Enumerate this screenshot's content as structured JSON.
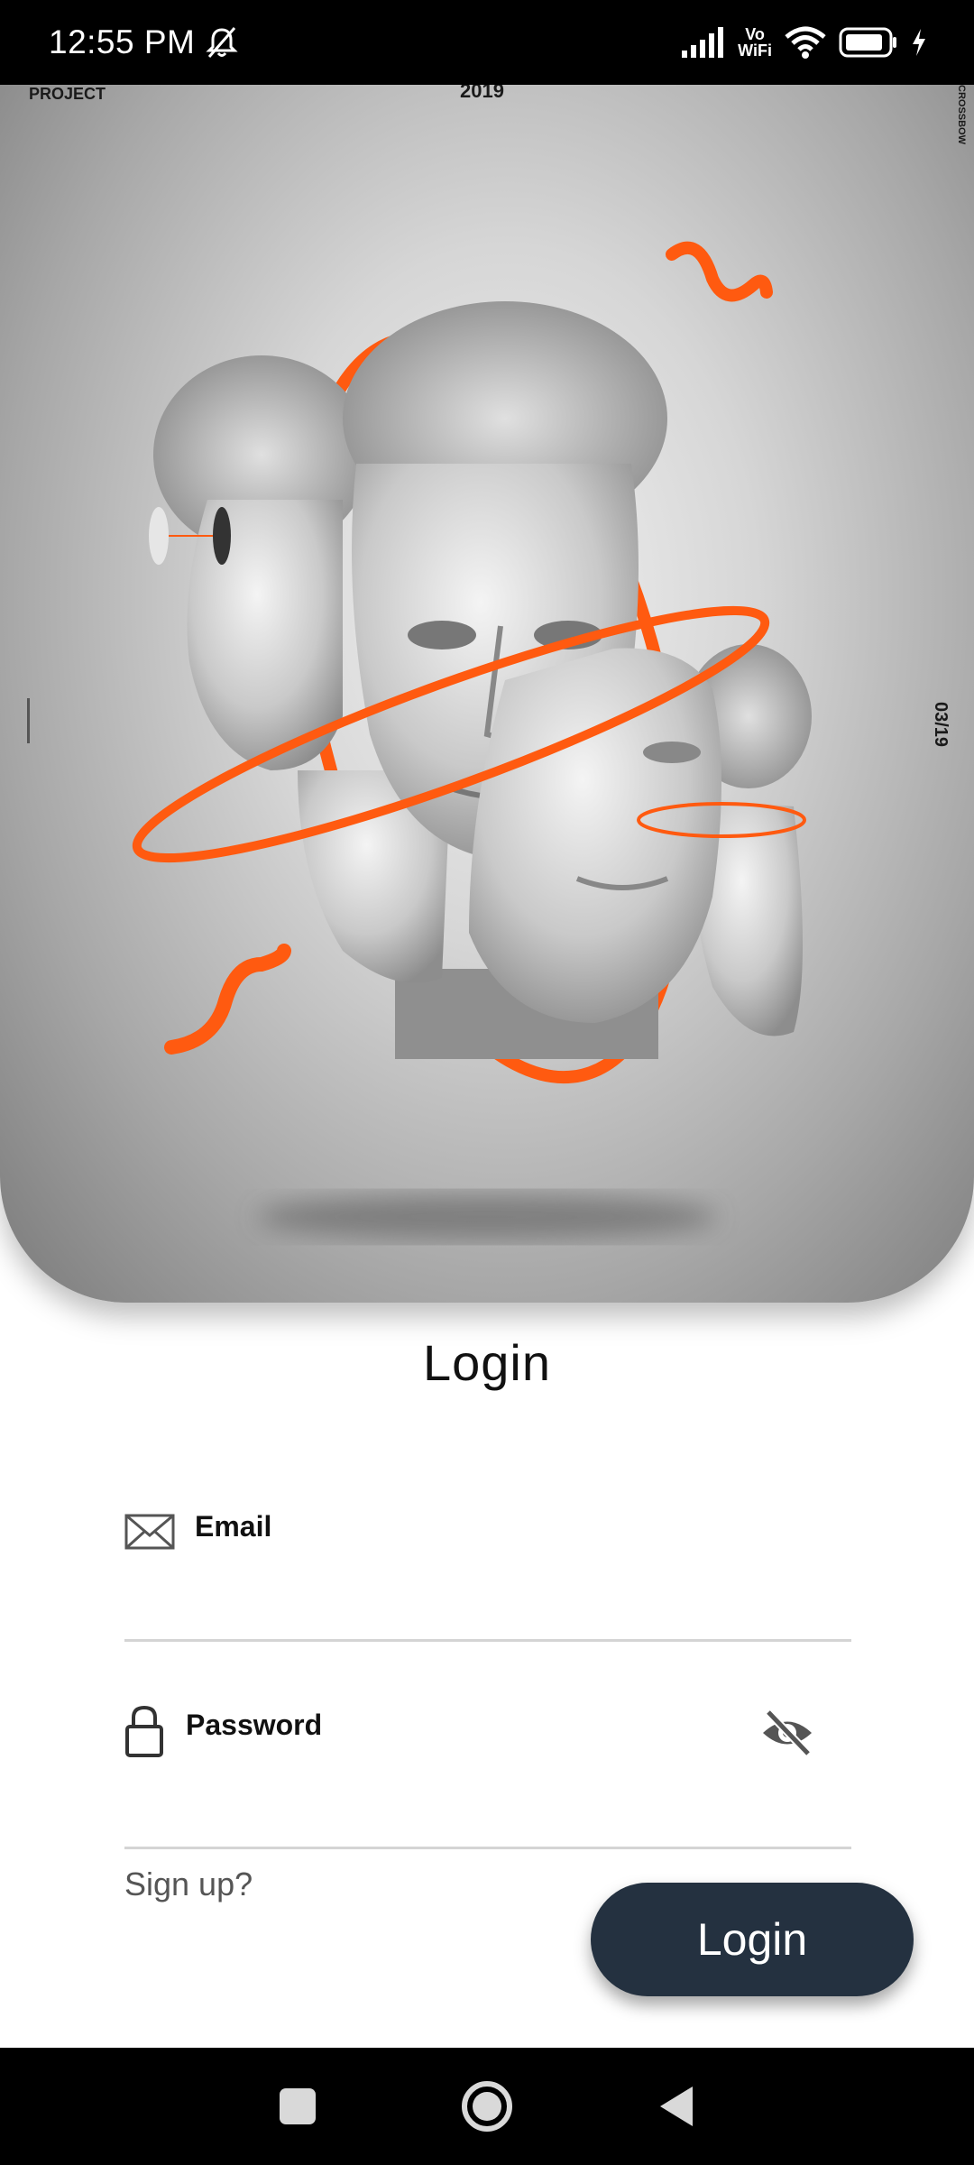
{
  "status_bar": {
    "time": "12:55 PM",
    "network_label_top": "Vo",
    "network_label_bottom": "WiFi",
    "icons": [
      "bell-off-icon",
      "signal-icon",
      "wifi-icon",
      "battery-icon",
      "charging-icon"
    ]
  },
  "hero": {
    "project_text": "PROJECT",
    "year_text": "2019",
    "crossbow_text": "CROSSBOW",
    "side_number": "03/19",
    "accent_color": "#ff5a10"
  },
  "login": {
    "title": "Login",
    "email_label": "Email",
    "email_value": "",
    "password_label": "Password",
    "password_value": "",
    "signup_text": "Sign up?",
    "button_label": "Login",
    "button_color": "#243140"
  },
  "nav_bar": {
    "icons": [
      "recent-apps-icon",
      "home-icon",
      "back-icon"
    ]
  }
}
